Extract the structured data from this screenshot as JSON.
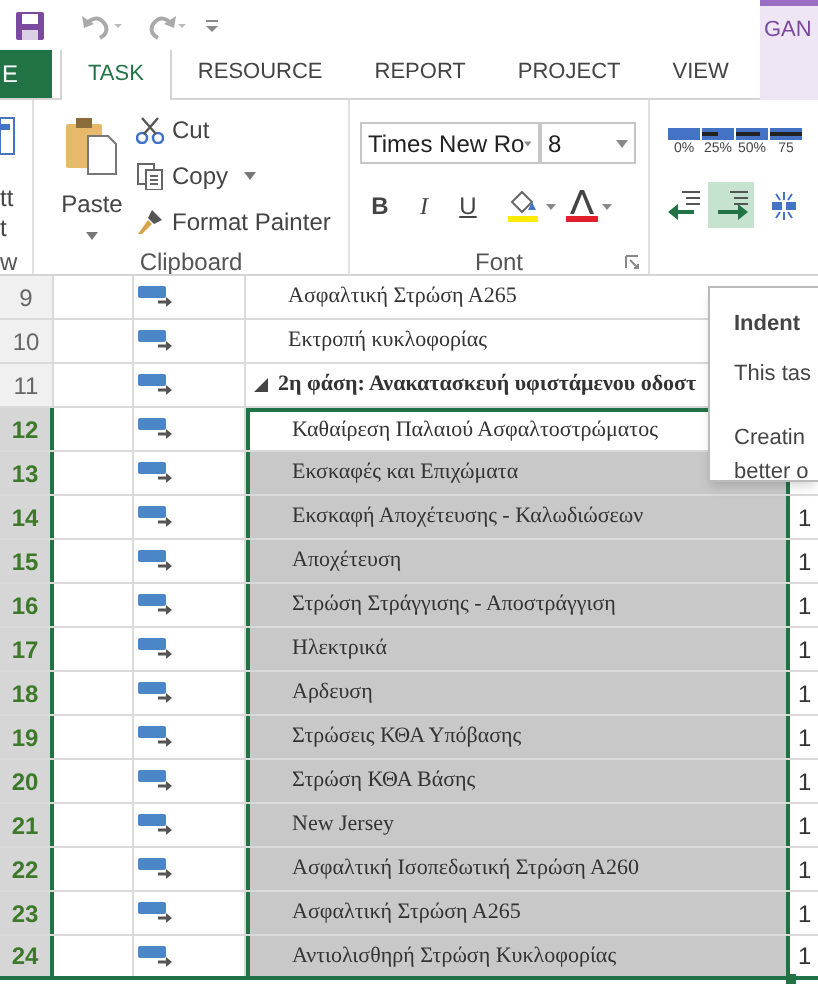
{
  "quick_access": {
    "context_tab": "GAN"
  },
  "tabs": [
    {
      "label": "E",
      "kind": "file",
      "selected": false
    },
    {
      "label": "TASK",
      "kind": "normal",
      "selected": true
    },
    {
      "label": "RESOURCE",
      "kind": "normal",
      "selected": false
    },
    {
      "label": "REPORT",
      "kind": "normal",
      "selected": false
    },
    {
      "label": "PROJECT",
      "kind": "normal",
      "selected": false
    },
    {
      "label": "VIEW",
      "kind": "normal",
      "selected": false
    }
  ],
  "ribbon": {
    "view_group": {
      "labels": [
        "tt",
        "t"
      ],
      "group_label": "w"
    },
    "clipboard": {
      "paste": "Paste",
      "cut": "Cut",
      "copy": "Copy",
      "format_painter": "Format Painter",
      "group_label": "Clipboard"
    },
    "font": {
      "font_name": "Times New Ro",
      "font_size": "8",
      "group_label": "Font",
      "bold": "B",
      "italic": "I",
      "underline": "U"
    },
    "schedule": {
      "percent_buttons": [
        "0%",
        "25%",
        "50%",
        "75"
      ],
      "indent_selected": true
    }
  },
  "rows": [
    {
      "id": "9",
      "kind": "task",
      "name": "Ασφαλτική Στρώση Α265",
      "selected": false,
      "active": false
    },
    {
      "id": "10",
      "kind": "task",
      "name": "Εκτροπή κυκλοφορίας",
      "selected": false,
      "active": false
    },
    {
      "id": "11",
      "kind": "summary",
      "expanded": true,
      "name": "2η φάση: Ανακατασκευή υφιστάμενου οδοστ",
      "selected": false,
      "active": false
    },
    {
      "id": "12",
      "kind": "task",
      "name": "Καθαίρεση Παλαιού Ασφαλτοστρώματος",
      "selected": true,
      "active": true
    },
    {
      "id": "13",
      "kind": "task",
      "name": "Εκσκαφές και Επιχώματα",
      "selected": true,
      "active": false
    },
    {
      "id": "14",
      "kind": "task",
      "name": "Εκσκαφή Αποχέτευσης - Καλωδιώσεων",
      "selected": true,
      "active": false,
      "duration": "1"
    },
    {
      "id": "15",
      "kind": "task",
      "name": "Αποχέτευση",
      "selected": true,
      "active": false,
      "duration": "1"
    },
    {
      "id": "16",
      "kind": "task",
      "name": "Στρώση Στράγγισης - Αποστράγγιση",
      "selected": true,
      "active": false,
      "duration": "1"
    },
    {
      "id": "17",
      "kind": "task",
      "name": "Ηλεκτρικά",
      "selected": true,
      "active": false,
      "duration": "1"
    },
    {
      "id": "18",
      "kind": "task",
      "name": "Αρδευση",
      "selected": true,
      "active": false,
      "duration": "1"
    },
    {
      "id": "19",
      "kind": "task",
      "name": "Στρώσεις ΚΘΑ Υπόβασης",
      "selected": true,
      "active": false,
      "duration": "1"
    },
    {
      "id": "20",
      "kind": "task",
      "name": "Στρώση ΚΘΑ Βάσης",
      "selected": true,
      "active": false,
      "duration": "1"
    },
    {
      "id": "21",
      "kind": "task",
      "name": "New Jersey",
      "selected": true,
      "active": false,
      "duration": "1"
    },
    {
      "id": "22",
      "kind": "task",
      "name": "Ασφαλτική Ισοπεδωτική Στρώση Α260",
      "selected": true,
      "active": false,
      "duration": "1"
    },
    {
      "id": "23",
      "kind": "task",
      "name": "Ασφαλτική Στρώση Α265",
      "selected": true,
      "active": false,
      "duration": "1"
    },
    {
      "id": "24",
      "kind": "task",
      "name": "Αντιολισθηρή Στρώση Κυκλοφορίας",
      "selected": true,
      "active": false,
      "duration": "1"
    }
  ],
  "tooltip": {
    "title": "Indent",
    "lines": [
      "This tas",
      "Creatin",
      "better o"
    ]
  }
}
